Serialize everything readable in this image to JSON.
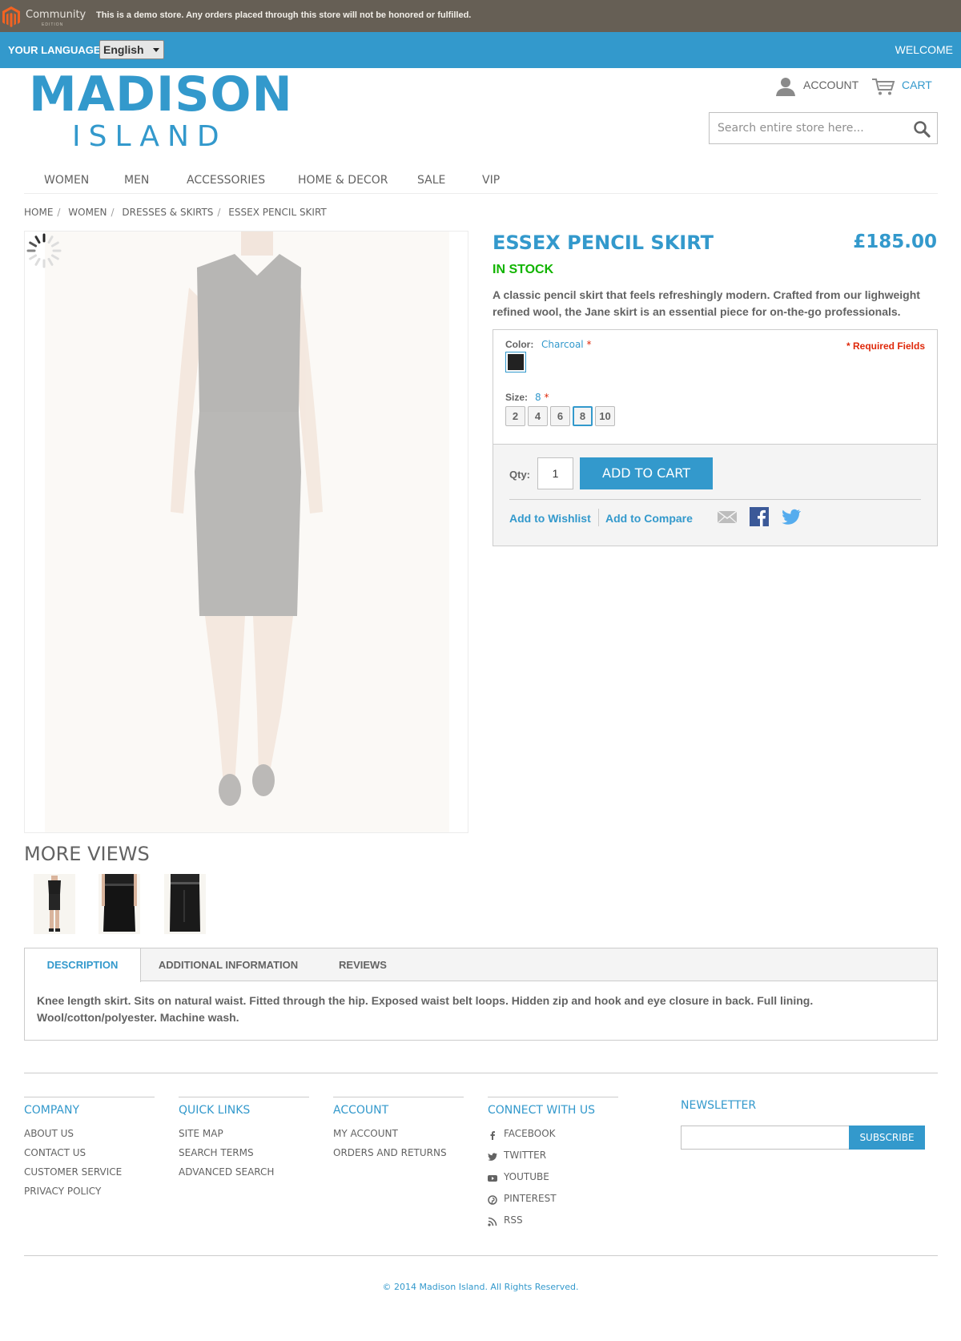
{
  "demo_notice": {
    "brand": "Community",
    "brand_sub": "EDITION",
    "text": "This is a demo store. Any orders placed through this store will not be honored or fulfilled."
  },
  "language_bar": {
    "label": "YOUR LANGUAGE:",
    "selected_language": "English",
    "welcome": "WELCOME"
  },
  "header": {
    "logo_main": "MADISON",
    "logo_sub": "ISLAND",
    "account": "ACCOUNT",
    "cart": "CART",
    "search_placeholder": "Search entire store here..."
  },
  "nav": [
    "WOMEN",
    "MEN",
    "ACCESSORIES",
    "HOME & DECOR",
    "SALE",
    "VIP"
  ],
  "breadcrumb": [
    "HOME",
    "WOMEN",
    "DRESSES & SKIRTS",
    "ESSEX PENCIL SKIRT"
  ],
  "product": {
    "name": "ESSEX PENCIL SKIRT",
    "price": "£185.00",
    "stock": "IN STOCK",
    "short_description": "A classic pencil skirt that feels refreshingly modern. Crafted from our lighweight refined wool, the Jane skirt is an essential piece for on-the-go professionals.",
    "more_views_title": "MORE VIEWS",
    "options": {
      "color_label": "Color:",
      "color_value": "Charcoal",
      "swatch_color": "#222222",
      "size_label": "Size:",
      "size_value": "8",
      "sizes": [
        "2",
        "4",
        "6",
        "8",
        "10"
      ],
      "selected_size": "8",
      "required_fields": "* Required Fields",
      "required_star": "*"
    },
    "cart": {
      "qty_label": "Qty:",
      "qty_value": "1",
      "add_to_cart": "ADD TO CART",
      "wishlist": "Add to Wishlist",
      "compare": "Add to Compare"
    }
  },
  "tabs": {
    "items": [
      "DESCRIPTION",
      "ADDITIONAL INFORMATION",
      "REVIEWS"
    ],
    "active": "DESCRIPTION",
    "description": "Knee length skirt. Sits on natural waist. Fitted through the hip. Exposed waist belt loops. Hidden zip and hook and eye closure in back. Full lining. Wool/cotton/polyester. Machine wash."
  },
  "footer": {
    "company": {
      "title": "COMPANY",
      "links": [
        "ABOUT US",
        "CONTACT US",
        "CUSTOMER SERVICE",
        "PRIVACY POLICY"
      ]
    },
    "quick_links": {
      "title": "QUICK LINKS",
      "links": [
        "SITE MAP",
        "SEARCH TERMS",
        "ADVANCED SEARCH"
      ]
    },
    "account": {
      "title": "ACCOUNT",
      "links": [
        "MY ACCOUNT",
        "ORDERS AND RETURNS"
      ]
    },
    "connect": {
      "title": "CONNECT WITH US",
      "links": [
        "FACEBOOK",
        "TWITTER",
        "YOUTUBE",
        "PINTEREST",
        "RSS"
      ]
    },
    "newsletter": {
      "title": "NEWSLETTER",
      "button": "SUBSCRIBE"
    },
    "copyright": "© 2014 Madison Island. All Rights Reserved."
  },
  "colors": {
    "brand_blue": "#3399cc",
    "demo_bar": "#665f55",
    "in_stock": "#11b400",
    "required": "#df280a",
    "text": "#636363"
  }
}
